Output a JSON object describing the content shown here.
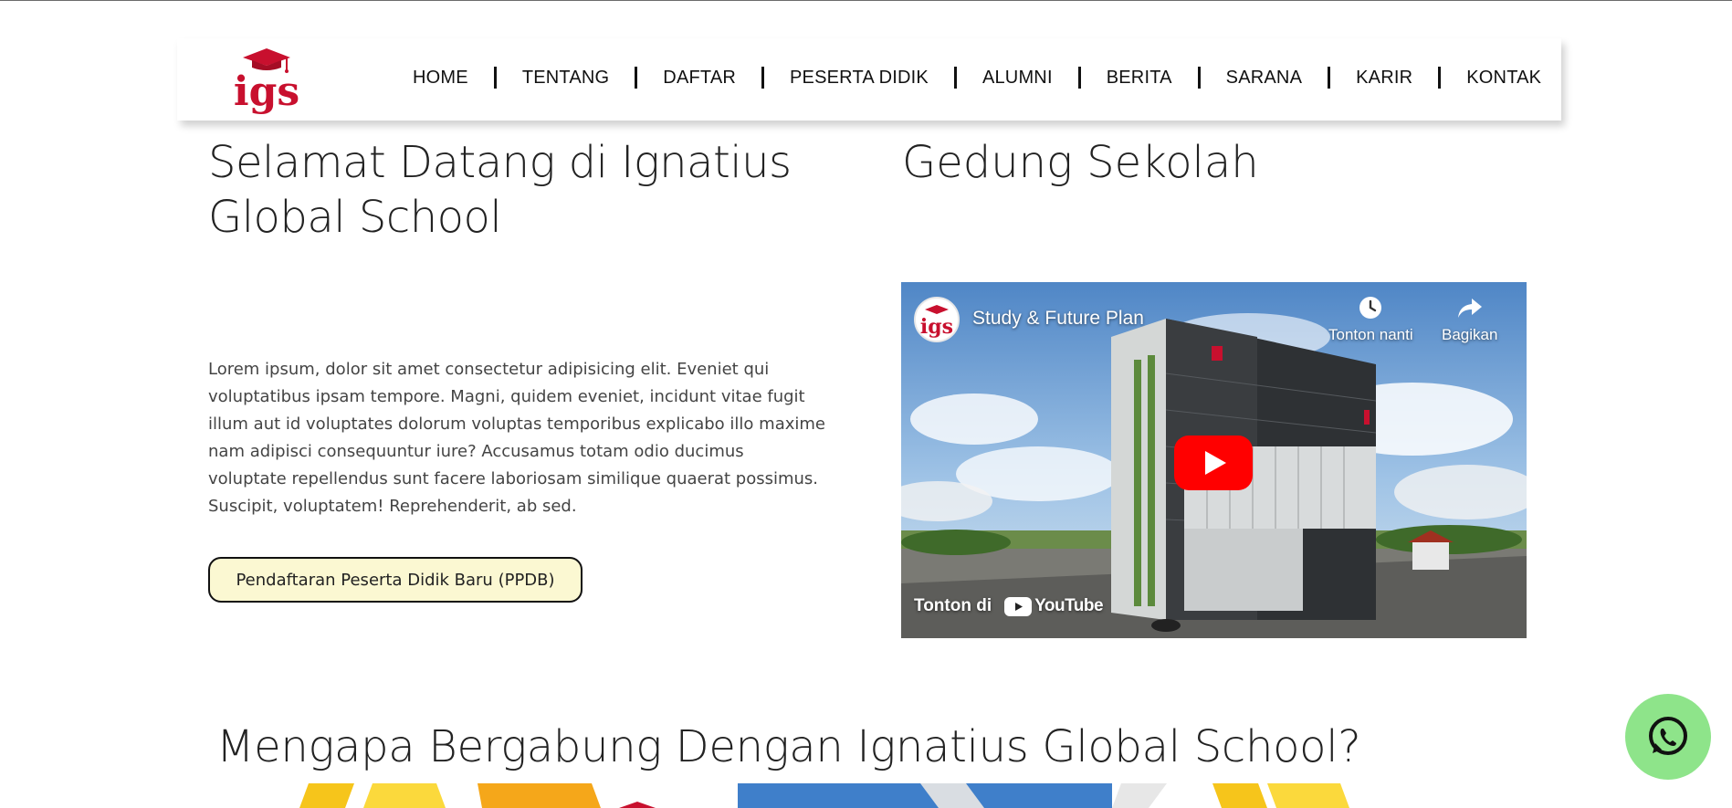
{
  "brand": {
    "logo_text": "igs"
  },
  "nav": {
    "items": [
      {
        "label": "HOME",
        "name": "nav-home"
      },
      {
        "label": "TENTANG",
        "name": "nav-tentang"
      },
      {
        "label": "DAFTAR",
        "name": "nav-daftar"
      },
      {
        "label": "PESERTA DIDIK",
        "name": "nav-peserta-didik"
      },
      {
        "label": "ALUMNI",
        "name": "nav-alumni"
      },
      {
        "label": "BERITA",
        "name": "nav-berita"
      },
      {
        "label": "SARANA",
        "name": "nav-sarana"
      },
      {
        "label": "KARIR",
        "name": "nav-karir"
      },
      {
        "label": "KONTAK",
        "name": "nav-kontak"
      }
    ]
  },
  "welcome": {
    "title": "Selamat Datang di Ignatius Global School",
    "body": "Lorem ipsum, dolor sit amet consectetur adipisicing elit. Eveniet qui voluptatibus ipsam tempore. Magni, quidem eveniet, incidunt vitae fugit illum aut id voluptates dolorum voluptas temporibus explicabo illo maxime nam adipisci consequuntur iure? Accusamus totam odio ducimus voluptate repellendus sunt facere laboriosam similique quaerat possimus. Suscipit, voluptatem! Reprehenderit, ab sed.",
    "cta_label": "Pendaftaran Peserta Didik Baru (PPDB)"
  },
  "building": {
    "title": "Gedung Sekolah",
    "video": {
      "title": "Study & Future Plan",
      "watch_later": "Tonton nanti",
      "share": "Bagikan",
      "watch_on": "Tonton di",
      "platform": "YouTube"
    }
  },
  "why": {
    "title": "Mengapa Bergabung Dengan Ignatius Global School?"
  },
  "colors": {
    "brand_red": "#c8102e",
    "cta_background": "#fbf8d2",
    "whatsapp_green": "#8ee48a",
    "youtube_red": "#ff0000"
  },
  "icons": {
    "whatsapp": "whatsapp-icon",
    "clock": "clock-icon",
    "share": "share-icon",
    "play": "play-icon"
  }
}
